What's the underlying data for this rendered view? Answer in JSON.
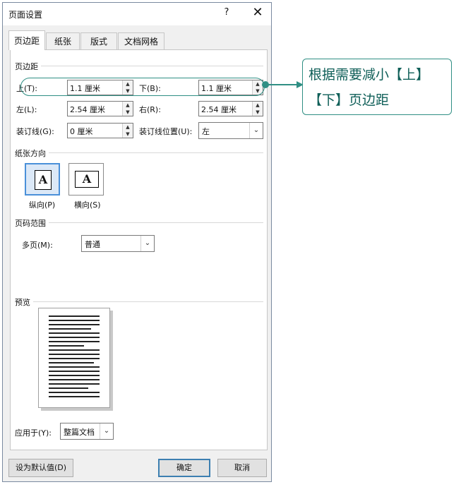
{
  "dialog": {
    "title": "页面设置",
    "help_label": "?",
    "close_label": "✕"
  },
  "tabs": [
    "页边距",
    "纸张",
    "版式",
    "文档网格"
  ],
  "margins": {
    "section": "页边距",
    "top_label": "上(T):",
    "top_value": "1.1 厘米",
    "bottom_label": "下(B):",
    "bottom_value": "1.1 厘米",
    "left_label": "左(L):",
    "left_value": "2.54 厘米",
    "right_label": "右(R):",
    "right_value": "2.54 厘米",
    "gutter_label": "装订线(G):",
    "gutter_value": "0 厘米",
    "gutter_pos_label": "装订线位置(U):",
    "gutter_pos_value": "左"
  },
  "orientation": {
    "section": "纸张方向",
    "portrait_label": "纵向(P)",
    "landscape_label": "横向(S)",
    "selected": "portrait"
  },
  "pages": {
    "section": "页码范围",
    "multiple_label": "多页(M):",
    "multiple_value": "普通"
  },
  "preview": {
    "section": "预览"
  },
  "apply": {
    "label": "应用于(Y):",
    "value": "整篇文档"
  },
  "buttons": {
    "default_label": "设为默认值(D)",
    "ok_label": "确定",
    "cancel_label": "取消"
  },
  "callout": {
    "line1": "根据需要减小【上】",
    "line2": "【下】页边距"
  },
  "colors": {
    "callout_border": "#2f8f84",
    "callout_text": "#0f5f58",
    "selection": "#4a90d9"
  }
}
